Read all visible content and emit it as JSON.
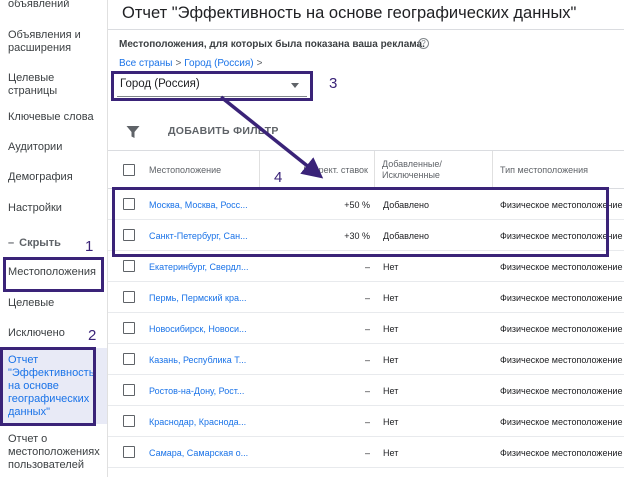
{
  "sidebar": {
    "items": [
      {
        "label": "объявлений"
      },
      {
        "label": "Объявления и расширения"
      },
      {
        "label": "Целевые страницы"
      },
      {
        "label": "Ключевые слова"
      },
      {
        "label": "Аудитории"
      },
      {
        "label": "Демография"
      },
      {
        "label": "Настройки"
      },
      {
        "label": "Скрыть"
      },
      {
        "label": "Местоположения"
      },
      {
        "label": "Целевые"
      },
      {
        "label": "Исключено"
      },
      {
        "label": "Отчет \"Эффективность на основе географических данных\""
      },
      {
        "label": "Отчет о местоположениях пользователей"
      }
    ]
  },
  "header": {
    "title": "Отчет \"Эффективность на основе географических данных\""
  },
  "main": {
    "subtitle": "Местоположения, для которых была показана ваша реклама.",
    "help_glyph": "?",
    "breadcrumb": {
      "root": "Все страны",
      "separator": ">",
      "current": "Город (Россия)",
      "trail_sep": ">"
    },
    "dropdown_value": "Город (Россия)",
    "add_filter_label": "ДОБАВИТЬ ФИЛЬТР"
  },
  "table": {
    "headers": {
      "location": "Местоположение",
      "bid_adj": "Коррект. ставок",
      "added_excluded": "Добавленные/ Исключенные",
      "location_type": "Тип местоположения"
    },
    "rows": [
      {
        "location": "Москва, Москва, Росс...",
        "bid": "+50 %",
        "status": "Добавлено",
        "type": "Физическое местоположение"
      },
      {
        "location": "Санкт-Петербург, Сан...",
        "bid": "+30 %",
        "status": "Добавлено",
        "type": "Физическое местоположение"
      },
      {
        "location": "Екатеринбург, Свердл...",
        "bid": "–",
        "status": "Нет",
        "type": "Физическое местоположение"
      },
      {
        "location": "Пермь, Пермский кра...",
        "bid": "–",
        "status": "Нет",
        "type": "Физическое местоположение"
      },
      {
        "location": "Новосибирск, Новоси...",
        "bid": "–",
        "status": "Нет",
        "type": "Физическое местоположение"
      },
      {
        "location": "Казань, Республика Т...",
        "bid": "–",
        "status": "Нет",
        "type": "Физическое местоположение"
      },
      {
        "location": "Ростов-на-Дону, Рост...",
        "bid": "–",
        "status": "Нет",
        "type": "Физическое местоположение"
      },
      {
        "location": "Краснодар, Краснода...",
        "bid": "–",
        "status": "Нет",
        "type": "Физическое местоположение"
      },
      {
        "location": "Самара, Самарская о...",
        "bid": "–",
        "status": "Нет",
        "type": "Физическое местоположение"
      }
    ]
  },
  "annotations": {
    "n1": "1",
    "n2": "2",
    "n3": "3",
    "n4": "4",
    "color": "#3a2378"
  },
  "colors": {
    "link": "#1a73e8",
    "active_bg": "#e8eaf6",
    "annotation": "#3a2378"
  }
}
